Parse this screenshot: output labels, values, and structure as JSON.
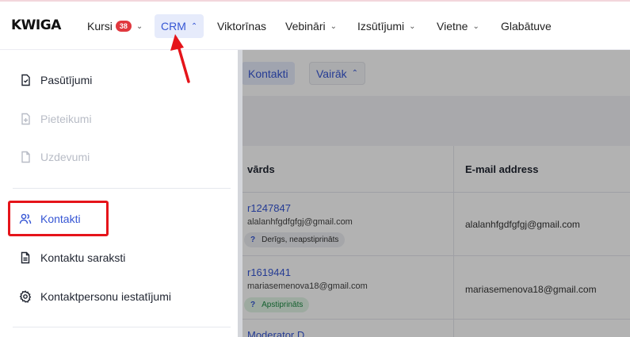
{
  "app": {
    "logo": "KWIGA"
  },
  "nav": {
    "items": [
      {
        "label": "Kursi",
        "badge": "38",
        "chevron": true
      },
      {
        "label": "CRM",
        "chevron": true,
        "active": true
      },
      {
        "label": "Viktorīnas"
      },
      {
        "label": "Vebināri",
        "chevron": true
      },
      {
        "label": "Izsūtījumi",
        "chevron": true
      },
      {
        "label": "Vietne",
        "chevron": true
      },
      {
        "label": "Glabātuve"
      }
    ]
  },
  "background": {
    "tabs": [
      {
        "label": "Kontakti"
      },
      {
        "label": "Vairāk"
      }
    ],
    "table": {
      "headers": [
        "vārds",
        "E-mail address"
      ],
      "rows": [
        {
          "name": "r1247847",
          "sub": "alalanhfgdfgfgj@gmail.com",
          "status": "Derīgs, neapstiprināts",
          "email": "alalanhfgdfgfgj@gmail.com"
        },
        {
          "name": "r1619441",
          "sub": "mariasemenova18@gmail.com",
          "status": "Apstiprināts",
          "email": "mariasemenova18@gmail.com"
        },
        {
          "name": "Moderator D",
          "sub": "",
          "status": "",
          "email": ""
        }
      ]
    }
  },
  "menu": {
    "items": [
      {
        "label": "Pasūtījumi",
        "icon": "order-check-icon",
        "state": "normal"
      },
      {
        "label": "Pieteikumi",
        "icon": "application-plus-icon",
        "state": "disabled"
      },
      {
        "label": "Uzdevumi",
        "icon": "file-icon",
        "state": "disabled"
      },
      {
        "label": "Kontakti",
        "icon": "users-icon",
        "state": "active"
      },
      {
        "label": "Kontaktu saraksti",
        "icon": "list-document-icon",
        "state": "normal"
      },
      {
        "label": "Kontaktpersonu iestatījumi",
        "icon": "gear-icon",
        "state": "normal"
      }
    ]
  },
  "colors": {
    "accent": "#3656d4",
    "highlight": "#e5141a",
    "badge": "#e0383e"
  }
}
